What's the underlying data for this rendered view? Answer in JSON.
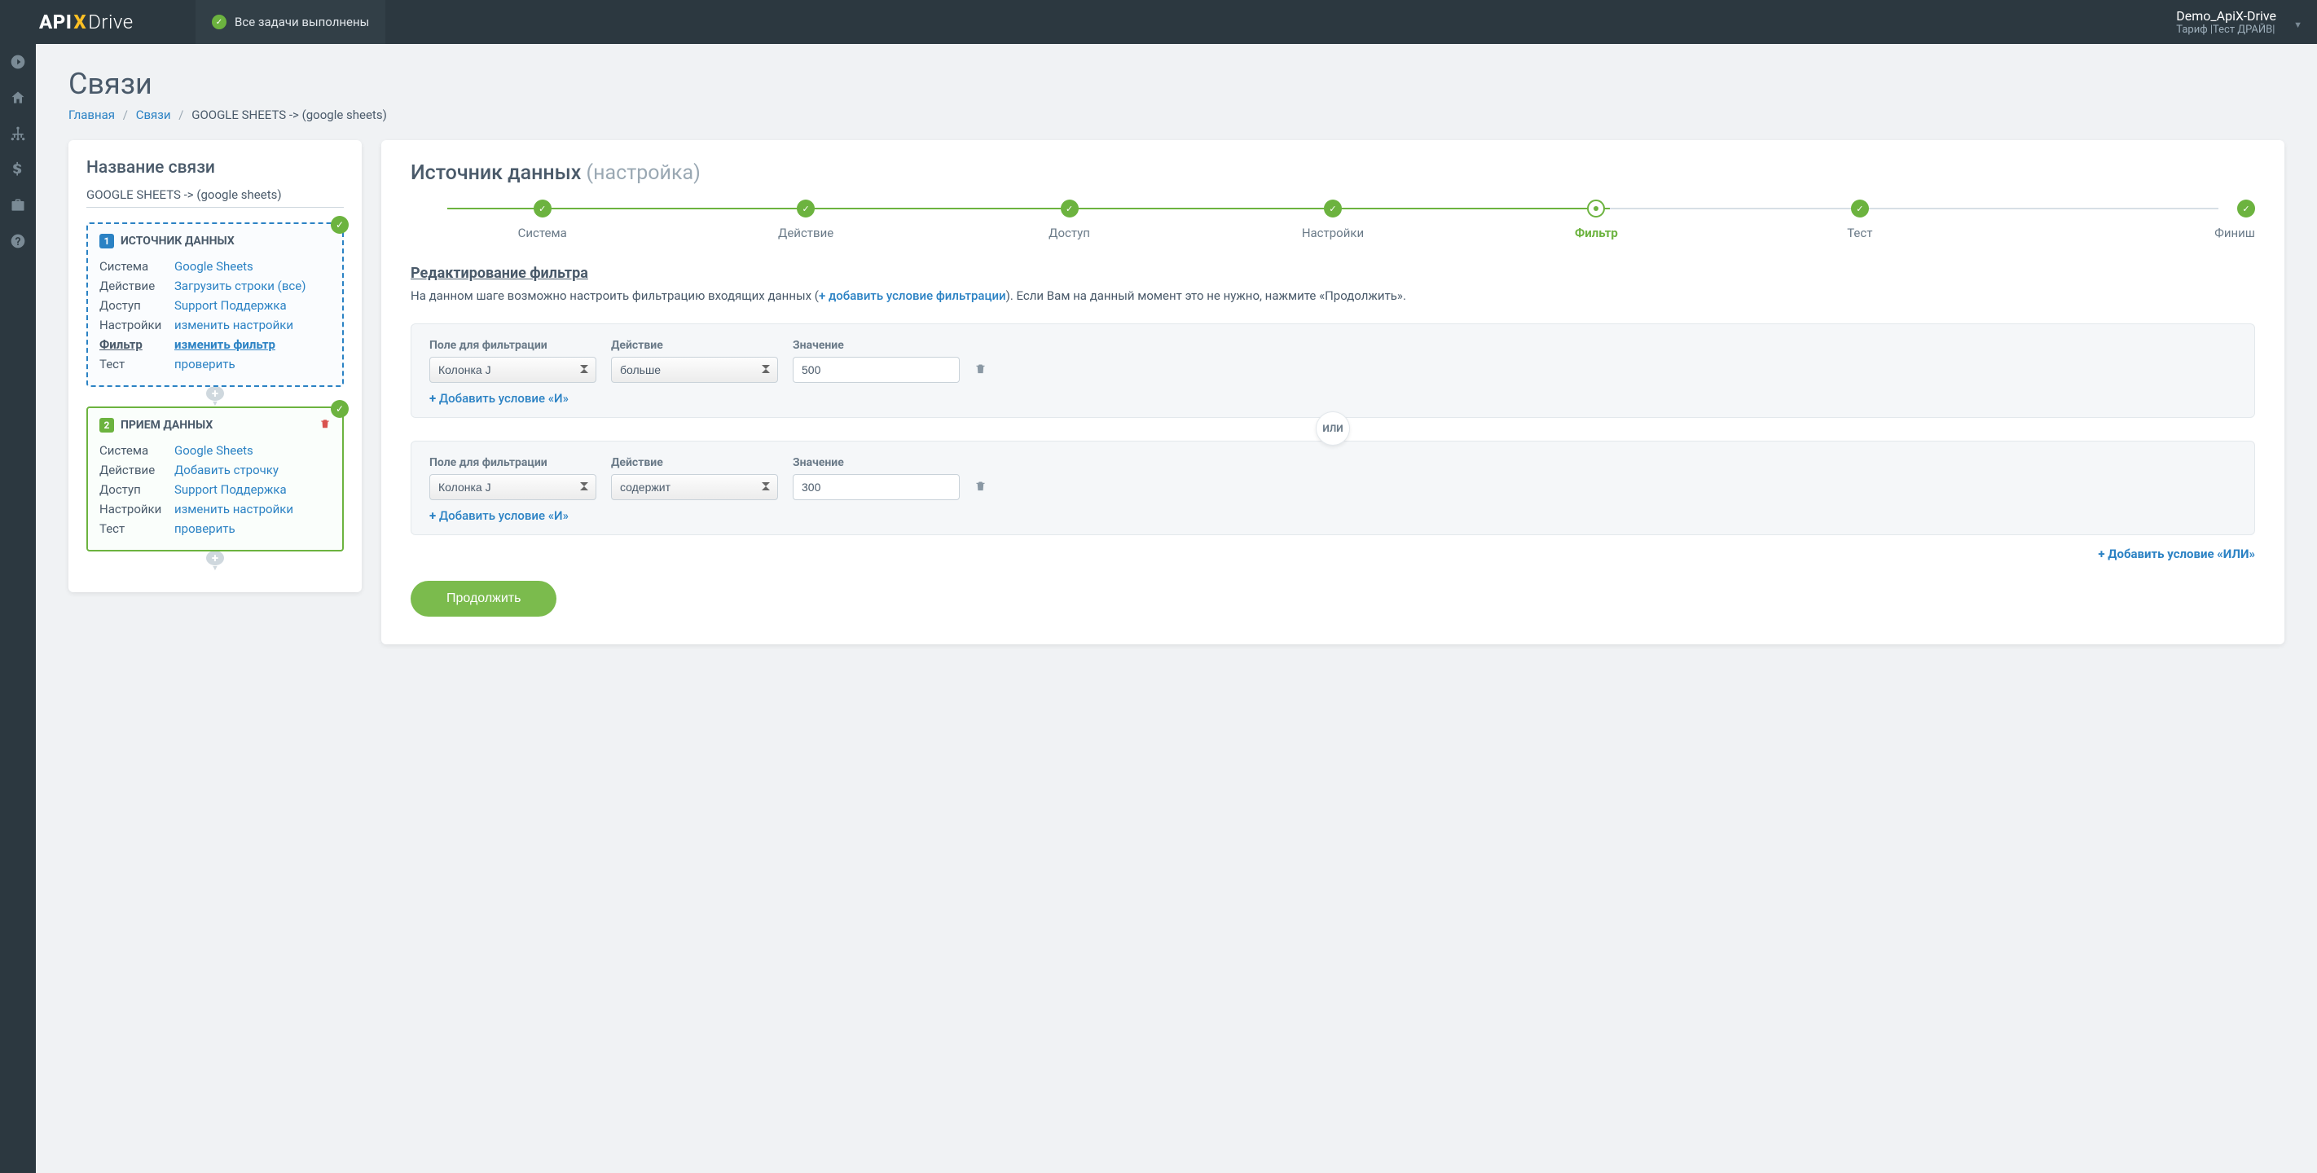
{
  "topbar": {
    "logo_api": "API",
    "logo_x": "X",
    "logo_drive": "Drive",
    "tasks_done": "Все задачи выполнены",
    "account_name": "Demo_ApiX-Drive",
    "account_tariff": "Тариф |Тест ДРАЙВ|"
  },
  "page": {
    "title": "Связи",
    "crumb_home": "Главная",
    "crumb_links": "Связи",
    "crumb_current": "GOOGLE SHEETS -> (google sheets)"
  },
  "left": {
    "title": "Название связи",
    "conn_name": "GOOGLE SHEETS -> (google sheets)",
    "source": {
      "num": "1",
      "header": "ИСТОЧНИК ДАННЫХ",
      "rows": [
        {
          "lbl": "Система",
          "val": "Google Sheets"
        },
        {
          "lbl": "Действие",
          "val": "Загрузить строки (все)"
        },
        {
          "lbl": "Доступ",
          "val": "Support Поддержка"
        },
        {
          "lbl": "Настройки",
          "val": "изменить настройки"
        },
        {
          "lbl": "Фильтр",
          "val": "изменить фильтр",
          "bold": true
        },
        {
          "lbl": "Тест",
          "val": "проверить"
        }
      ]
    },
    "dest": {
      "num": "2",
      "header": "ПРИЕМ ДАННЫХ",
      "rows": [
        {
          "lbl": "Система",
          "val": "Google Sheets"
        },
        {
          "lbl": "Действие",
          "val": "Добавить строчку"
        },
        {
          "lbl": "Доступ",
          "val": "Support Поддержка"
        },
        {
          "lbl": "Настройки",
          "val": "изменить настройки"
        },
        {
          "lbl": "Тест",
          "val": "проверить"
        }
      ]
    }
  },
  "right": {
    "title_main": "Источник данных",
    "title_sub": "(настройка)",
    "steps": [
      "Система",
      "Действие",
      "Доступ",
      "Настройки",
      "Фильтр",
      "Тест",
      "Финиш"
    ],
    "section_heading": "Редактирование фильтра",
    "section_desc_1": "На данном шаге возможно настроить фильтрацию входящих данных (",
    "section_desc_link": "+ добавить условие фильтрации",
    "section_desc_2": "). Если Вам на данный момент это не нужно, нажмите «Продолжить».",
    "labels": {
      "field": "Поле для фильтрации",
      "action": "Действие",
      "value": "Значение"
    },
    "groups": [
      {
        "field": "Колонка J",
        "action": "больше",
        "value": "500"
      },
      {
        "field": "Колонка J",
        "action": "содержит",
        "value": "300"
      }
    ],
    "or_label": "ИЛИ",
    "add_and": "Добавить условие «И»",
    "add_or": "Добавить условие «ИЛИ»",
    "continue": "Продолжить"
  }
}
